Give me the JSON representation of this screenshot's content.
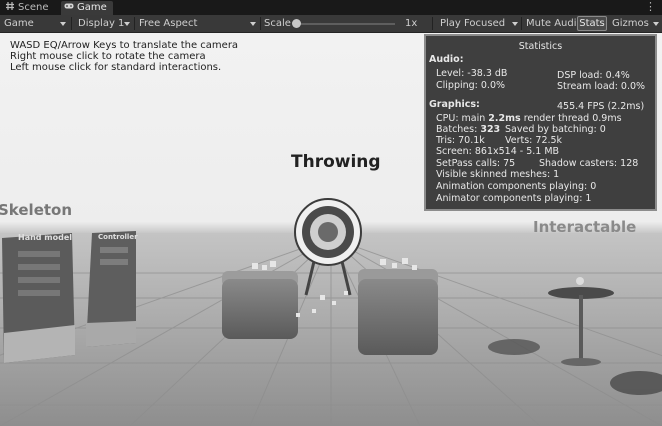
{
  "tabs": [
    {
      "label": "Scene",
      "icon": "scene-hash-icon",
      "active": false
    },
    {
      "label": "Game",
      "icon": "game-controller-icon",
      "active": true
    }
  ],
  "toolbar": {
    "display_mode": "Game",
    "display": "Display 1",
    "aspect": "Free Aspect",
    "scale_label": "Scale",
    "scale_value": "1x",
    "scale_fraction": 0.0,
    "play_mode": "Play Focused",
    "mute": "Mute Audio",
    "stats": "Stats",
    "gizmos": "Gizmos"
  },
  "help_text": [
    "WASD EQ/Arrow Keys to translate the camera",
    "Right mouse click to rotate the camera",
    "Left mouse click for standard interactions."
  ],
  "stats": {
    "title": "Statistics",
    "audio_header": "Audio:",
    "level": "Level: -38.3 dB",
    "clipping": "Clipping: 0.0%",
    "dsp_load": "DSP load: 0.4%",
    "stream_load": "Stream load: 0.0%",
    "graphics_header": "Graphics:",
    "fps": "455.4 FPS (2.2ms)",
    "cpu_prefix": "CPU: main ",
    "cpu_main": "2.2ms",
    "cpu_suffix": "  render thread 0.9ms",
    "batches_prefix": "Batches: ",
    "batches": "323",
    "saved_batching": "Saved by batching: 0",
    "tris": "Tris: 70.1k",
    "verts": "Verts: 72.5k",
    "screen": "Screen: 861x514 - 5.1 MB",
    "setpass": "SetPass calls: 75",
    "shadow_casters": "Shadow casters: 128",
    "skinned": "Visible skinned meshes: 1",
    "anim_playing": "Animation components playing: 0",
    "animator_playing": "Animator components playing: 1"
  },
  "scene_labels": {
    "throwing": "Throwing",
    "skeleton": "Skeleton",
    "interactable": "Interactable",
    "hand_model": "Hand model",
    "controller": "Controller"
  },
  "colors": {
    "panel_bg": "#303030",
    "panel_border": "#8c8c8c",
    "toolbar_bg": "#393939",
    "tabbar_bg": "#191919"
  }
}
